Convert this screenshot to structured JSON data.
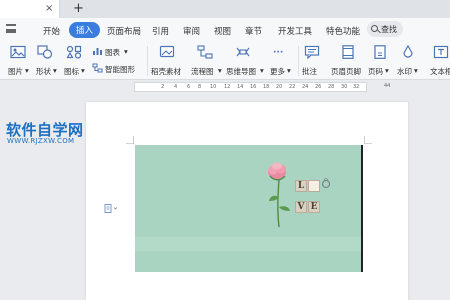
{
  "tabs": {
    "close_glyph": "×",
    "new_tab_glyph": "+"
  },
  "menu": {
    "items": [
      "开始",
      "插入",
      "页面布局",
      "引用",
      "审阅",
      "视图",
      "章节",
      "开发工具",
      "特色功能"
    ],
    "active": "插入",
    "search_label": "查找"
  },
  "ribbon": {
    "tools": [
      {
        "label": "图片",
        "icon": "picture-icon"
      },
      {
        "label": "形状",
        "icon": "shapes-icon"
      },
      {
        "label": "图标",
        "icon": "icons-icon"
      },
      {
        "label": "图表",
        "icon": "chart-icon"
      },
      {
        "label": "智能图形",
        "icon": "smartart-icon"
      },
      {
        "label": "稻壳素材",
        "icon": "material-icon"
      },
      {
        "label": "流程图",
        "icon": "flowchart-icon"
      },
      {
        "label": "思维导图",
        "icon": "mindmap-icon"
      },
      {
        "label": "更多",
        "icon": "more-icon"
      },
      {
        "label": "批注",
        "icon": "comment-icon"
      },
      {
        "label": "页眉页脚",
        "icon": "header-footer-icon"
      },
      {
        "label": "页码",
        "icon": "page-number-icon"
      },
      {
        "label": "水印",
        "icon": "watermark-icon"
      },
      {
        "label": "文本框",
        "icon": "textbox-icon"
      }
    ],
    "dropdown_glyph": "▾",
    "more_glyph": "··· "
  },
  "ruler": {
    "numbers": [
      "4",
      "2",
      "2",
      "4",
      "6",
      "8",
      "10",
      "12",
      "14",
      "16",
      "18",
      "20",
      "22",
      "24",
      "26",
      "28",
      "30",
      "32",
      "34",
      "36",
      "38",
      "44"
    ]
  },
  "document": {
    "tiles": [
      "L",
      "V",
      "E"
    ]
  },
  "watermark": {
    "title": "软件自学网",
    "url": "WWW.RJZXW.COM"
  },
  "colors": {
    "accent": "#3b7ddd",
    "banner": "#a9d4c2",
    "watermark": "#1c6fc2"
  }
}
